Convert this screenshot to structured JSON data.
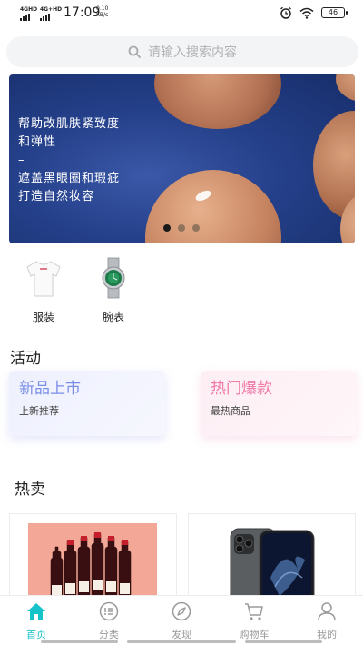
{
  "status_bar": {
    "signal1": "4GHD",
    "signal2": "4G+HD",
    "time": "17:09",
    "speed_value": "0.10",
    "speed_unit": "KB/s",
    "battery": "46"
  },
  "search": {
    "placeholder": "请输入搜索内容",
    "icon": "search-icon"
  },
  "banner": {
    "lines": [
      "帮助改肌肤紧致度",
      "和弹性",
      "–",
      "遮盖黑眼圈和瑕疵",
      "打造自然妆容"
    ],
    "slide_count": 3,
    "active_slide": 1
  },
  "categories": [
    {
      "label": "服装",
      "icon": "tshirt-icon"
    },
    {
      "label": "腕表",
      "icon": "watch-icon"
    }
  ],
  "activity": {
    "title": "活动",
    "cards": [
      {
        "title": "新品上市",
        "subtitle": "上新推荐",
        "color": "#7a8ee8"
      },
      {
        "title": "热门爆款",
        "subtitle": "最热商品",
        "color": "#f07aa8"
      }
    ]
  },
  "hot": {
    "title": "热卖",
    "items": [
      {
        "icon": "wine-bottles-image"
      },
      {
        "icon": "phone-image"
      }
    ]
  },
  "tabbar": {
    "active_color": "#16c3c8",
    "items": [
      {
        "label": "首页",
        "icon": "home-icon",
        "active": true
      },
      {
        "label": "分类",
        "icon": "category-list-icon",
        "active": false
      },
      {
        "label": "发现",
        "icon": "compass-icon",
        "active": false
      },
      {
        "label": "购物车",
        "icon": "cart-icon",
        "active": false
      },
      {
        "label": "我的",
        "icon": "user-icon",
        "active": false
      }
    ]
  }
}
